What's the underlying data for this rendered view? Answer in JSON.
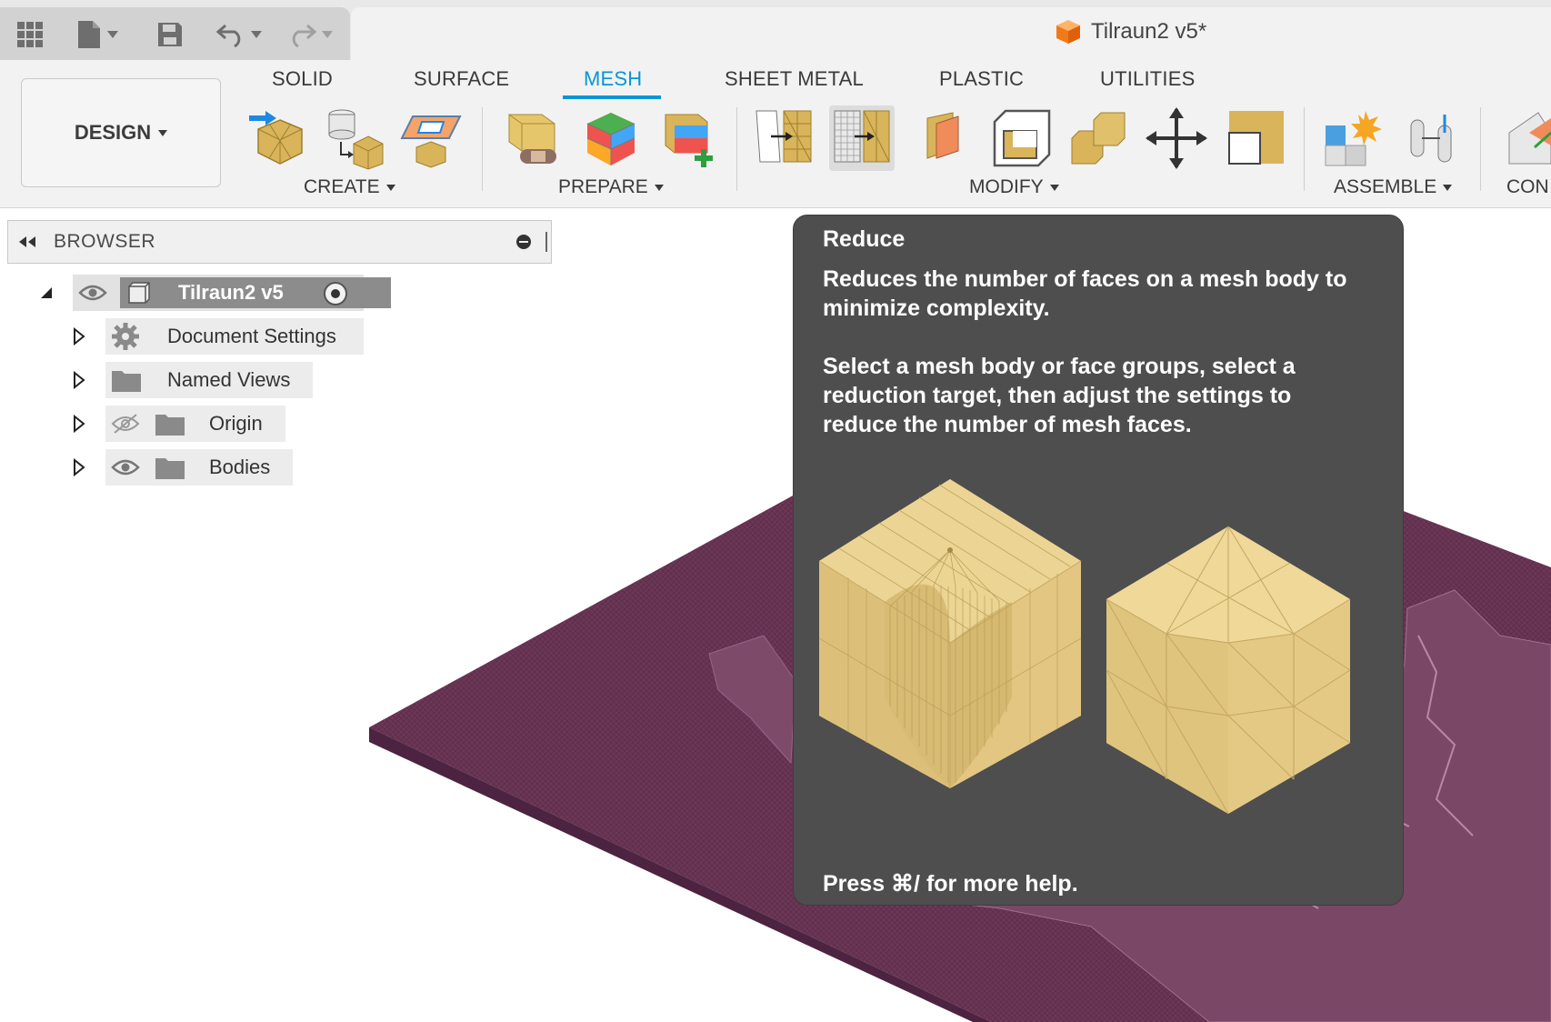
{
  "document": {
    "title": "Tilraun2 v5*"
  },
  "quick_access": {
    "icons": [
      "app-grid-icon",
      "file-icon",
      "save-icon",
      "undo-icon",
      "redo-icon"
    ]
  },
  "ribbon": {
    "workspace_label": "DESIGN",
    "tabs": [
      {
        "label": "SOLID",
        "active": false
      },
      {
        "label": "SURFACE",
        "active": false
      },
      {
        "label": "MESH",
        "active": true
      },
      {
        "label": "SHEET METAL",
        "active": false
      },
      {
        "label": "PLASTIC",
        "active": false
      },
      {
        "label": "UTILITIES",
        "active": false
      }
    ],
    "groups": {
      "create": "CREATE",
      "prepare": "PREPARE",
      "modify": "MODIFY",
      "assemble": "ASSEMBLE",
      "construct": "CON"
    }
  },
  "browser": {
    "title": "BROWSER",
    "root": "Tilraun2 v5",
    "items": [
      {
        "label": "Document Settings"
      },
      {
        "label": "Named Views"
      },
      {
        "label": "Origin"
      },
      {
        "label": "Bodies"
      }
    ]
  },
  "tooltip": {
    "title": "Reduce",
    "paragraph_1": "Reduces the number of faces on a mesh body to minimize complexity.",
    "paragraph_2": "Select a mesh body or face groups, select a reduction target, then adjust the settings to reduce the number of mesh faces.",
    "help": "Press ⌘/ for more help."
  },
  "colors": {
    "accent": "#0696d7",
    "mesh_gold": "#e0c77a",
    "terrain": "#6a3655",
    "tooltip_bg": "#4e4e4e"
  }
}
